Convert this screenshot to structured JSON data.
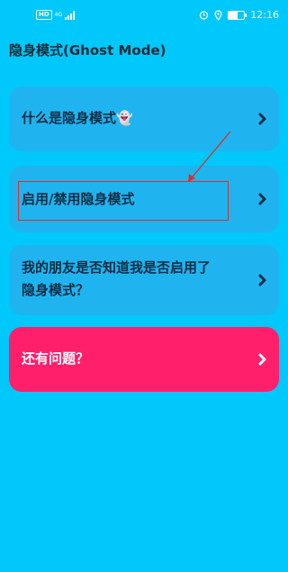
{
  "status_bar": {
    "left_badge": "HD",
    "network": "4G",
    "time": "12:16",
    "battery_level": 0.6
  },
  "header": {
    "title": "隐身模式(Ghost Mode)"
  },
  "menu": {
    "items": [
      {
        "label": "什么是隐身模式👻"
      },
      {
        "label": "启用/禁用隐身模式"
      },
      {
        "label_line1": "我的朋友是否知道我是否启用了",
        "label_line2": "隐身模式？"
      }
    ]
  },
  "help_button": {
    "label": "还有问题？"
  },
  "colors": {
    "background": "#00c8fb",
    "card": "#1fb4f0",
    "accent": "#ff1f6a",
    "annotation": "#d9302a"
  }
}
